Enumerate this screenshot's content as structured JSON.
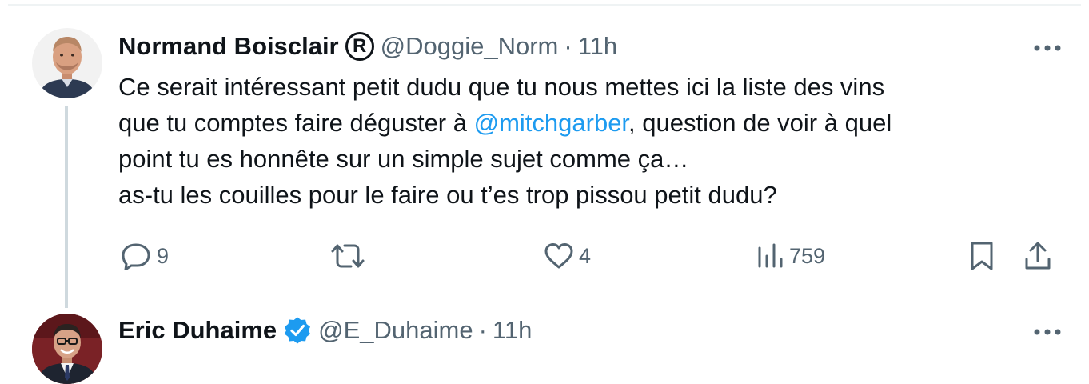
{
  "tweets": [
    {
      "author": {
        "display_name": "Normand Boisclair",
        "badge": "R",
        "handle": "@Doggie_Norm",
        "separator": "·",
        "time": "11h"
      },
      "text": {
        "part1": "Ce serait intéressant petit dudu que tu nous mettes ici la liste des vins\nque tu comptes faire déguster à ",
        "mention": "@mitchgarber",
        "part2": ", question de voir à quel\npoint tu es honnête sur un simple sujet comme ça…\nas-tu les couilles pour le faire ou t’es trop pissou petit dudu?"
      },
      "actions": {
        "replies": "9",
        "retweets": "",
        "likes": "4",
        "views": "759"
      }
    },
    {
      "author": {
        "display_name": "Eric Duhaime",
        "verified": true,
        "handle": "@E_Duhaime",
        "separator": "·",
        "time": "11h"
      }
    }
  ],
  "icons": {
    "more": "more-horizontal-icon",
    "reply": "reply-icon",
    "retweet": "retweet-icon",
    "like": "heart-icon",
    "views": "views-icon",
    "bookmark": "bookmark-icon",
    "share": "share-icon",
    "verified": "verified-badge-icon"
  },
  "colors": {
    "text": "#0f1419",
    "secondary": "#536471",
    "link": "#1d9bf0",
    "thread_line": "#cfd9de"
  }
}
